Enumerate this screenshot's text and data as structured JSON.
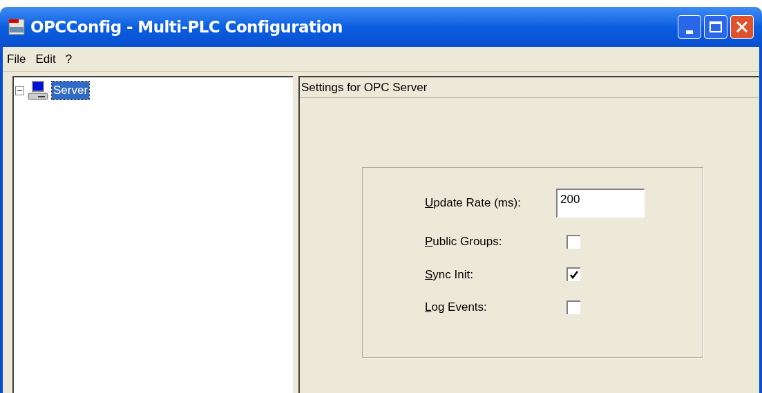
{
  "window": {
    "title": "OPCConfig - Multi-PLC Configuration"
  },
  "menu": [
    "File",
    "Edit",
    "?"
  ],
  "tree": [
    {
      "label": "Server",
      "selected": true,
      "expanded": true
    }
  ],
  "panel": {
    "header": "Settings for OPC Server"
  },
  "settings": [
    {
      "kind": "text",
      "label": "Update Rate (ms):",
      "value": "200"
    },
    {
      "kind": "checkbox",
      "label": "Public Groups:",
      "checked": false
    },
    {
      "kind": "checkbox",
      "label": "Sync Init:",
      "checked": true
    },
    {
      "kind": "checkbox",
      "label": "Log Events:",
      "checked": false
    }
  ]
}
